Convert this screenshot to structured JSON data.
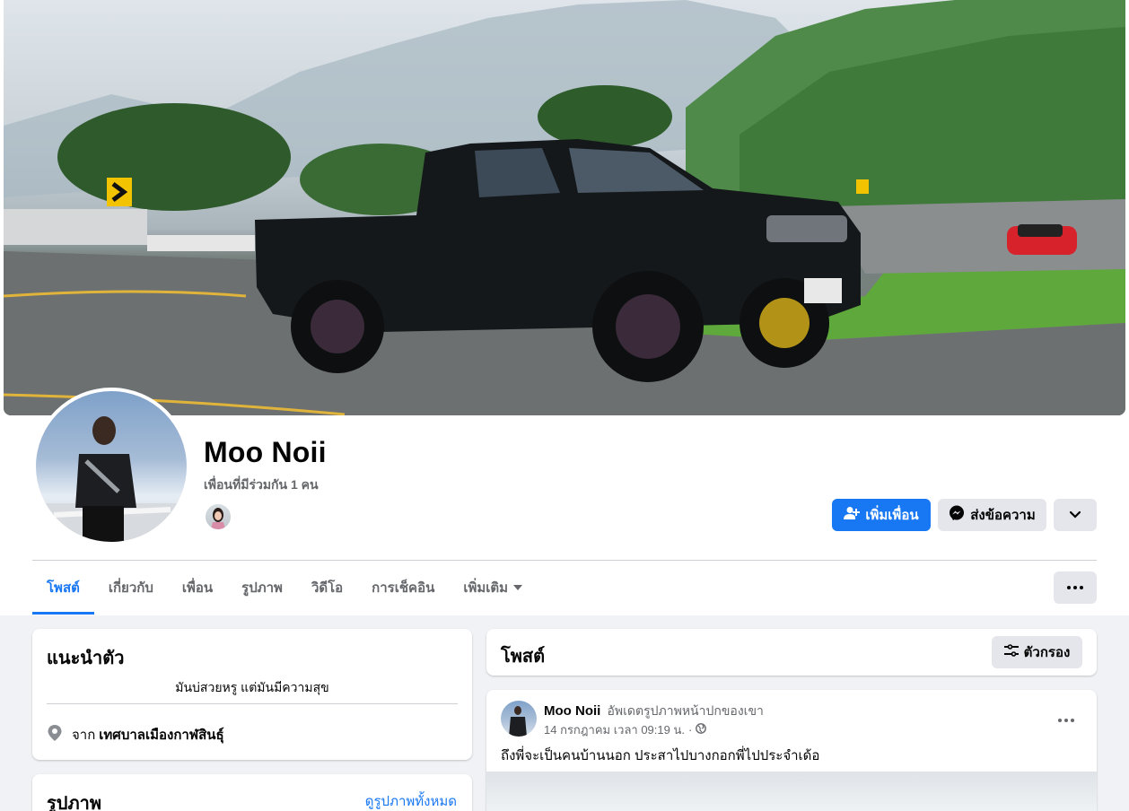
{
  "profile": {
    "name": "Moo Noii",
    "mutual_friends": "เพื่อนที่มีร่วมกัน 1 คน"
  },
  "actions": {
    "add_friend": "เพิ่มเพื่อน",
    "message": "ส่งข้อความ"
  },
  "tabs": [
    {
      "label": "โพสต์",
      "active": true
    },
    {
      "label": "เกี่ยวกับ"
    },
    {
      "label": "เพื่อน"
    },
    {
      "label": "รูปภาพ"
    },
    {
      "label": "วิดีโอ"
    },
    {
      "label": "การเช็คอิน"
    },
    {
      "label": "เพิ่มเติม"
    }
  ],
  "intro": {
    "title": "แนะนำตัว",
    "bio": "มันบ่สวยหรู แต่มันมีความสุข",
    "location_prefix": "จาก",
    "location": "เทศบาลเมืองกาฬสินธุ์"
  },
  "photos": {
    "title": "รูปภาพ",
    "see_all": "ดูรูปภาพทั้งหมด"
  },
  "posts": {
    "title": "โพสต์",
    "filter_label": "ตัวกรอง"
  },
  "post": {
    "author": "Moo Noii",
    "action": "อัพเดตรูปภาพหน้าปกของเขา",
    "timestamp": "14 กรกฎาคม เวลา 09:19 น.",
    "separator": "·",
    "text": "ถึงพี่จะเป็นคนบ้านนอก ประสาไปบางกอกพี่ไปประจำเด้อ"
  },
  "colors": {
    "accent": "#1877f2",
    "secondary_button": "#e4e6eb",
    "page_bg": "#f0f2f5",
    "secondary_text": "#65676b"
  },
  "icons": [
    "add-friend-icon",
    "messenger-icon",
    "chevron-down-icon",
    "more-icon",
    "location-pin-icon",
    "filter-icon",
    "globe-icon",
    "caret-down-icon"
  ]
}
